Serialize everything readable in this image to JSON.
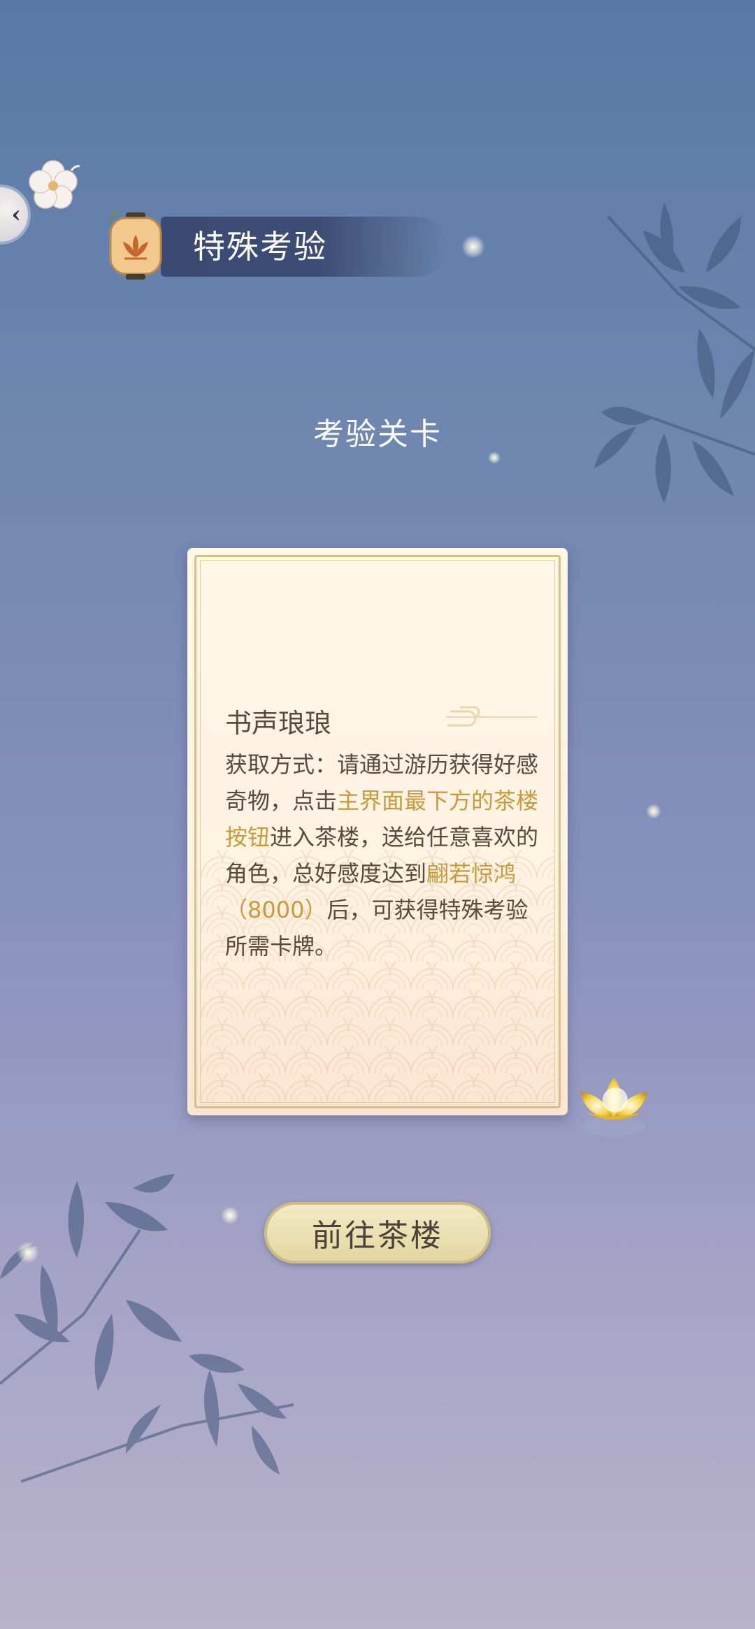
{
  "header": {
    "title": "特殊考验"
  },
  "section": {
    "title": "考验关卡"
  },
  "card": {
    "name": "书声琅琅",
    "desc_parts": [
      {
        "text": "获取方式：请通过游历获得好感奇物，点击",
        "highlight": false
      },
      {
        "text": "主界面最下方的茶楼按钮",
        "highlight": true
      },
      {
        "text": "进入茶楼，送给任意喜欢的角色，总好感度达到",
        "highlight": false
      },
      {
        "text": "翩若惊鸿（8000）",
        "highlight": true
      },
      {
        "text": "后，可获得特殊考验所需卡牌。",
        "highlight": false
      }
    ]
  },
  "actions": {
    "goto_label": "前往茶楼"
  },
  "colors": {
    "highlight": "#c99a3c",
    "banner": "#3b4a72",
    "button_fill": "#e8dcaa"
  },
  "icons": {
    "back": "chevron-left-icon",
    "flower": "flower-icon",
    "lantern": "lantern-icon",
    "lotus": "lotus-icon"
  }
}
